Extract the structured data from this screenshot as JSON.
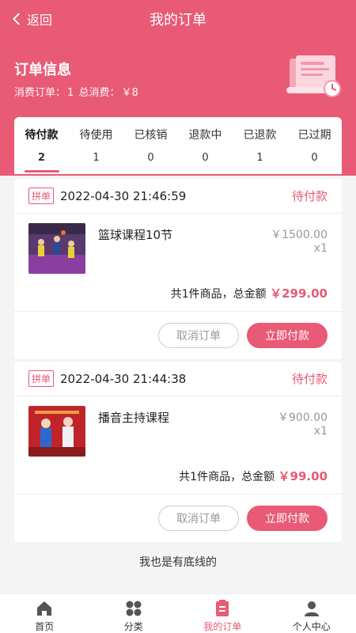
{
  "nav": {
    "back_label": "返回",
    "title": "我的订单"
  },
  "info": {
    "title": "订单信息",
    "orders_label": "消费订单：",
    "orders_count": "1",
    "total_label": "总消费：",
    "total_value": "￥8"
  },
  "tabs": [
    {
      "label": "待付款",
      "count": "2",
      "active": true
    },
    {
      "label": "待使用",
      "count": "1"
    },
    {
      "label": "已核销",
      "count": "0"
    },
    {
      "label": "退款中",
      "count": "0"
    },
    {
      "label": "已退款",
      "count": "1"
    },
    {
      "label": "已过期",
      "count": "0"
    }
  ],
  "orders": [
    {
      "badge": "拼单",
      "time": "2022-04-30 21:46:59",
      "status": "待付款",
      "product": "篮球课程10节",
      "price": "￥1500.00",
      "qty": "x1",
      "summary_prefix": "共1件商品，总金额",
      "amount": "￥299.00",
      "cancel_label": "取消订单",
      "pay_label": "立即付款"
    },
    {
      "badge": "拼单",
      "time": "2022-04-30 21:44:38",
      "status": "待付款",
      "product": "播音主持课程",
      "price": "￥900.00",
      "qty": "x1",
      "summary_prefix": "共1件商品，总金额",
      "amount": "￥99.00",
      "cancel_label": "取消订单",
      "pay_label": "立即付款"
    }
  ],
  "footer_note": "我也是有底线的",
  "tabbar": [
    {
      "label": "首页",
      "icon": "home-icon"
    },
    {
      "label": "分类",
      "icon": "category-icon"
    },
    {
      "label": "我的订单",
      "icon": "orders-icon",
      "active": true
    },
    {
      "label": "个人中心",
      "icon": "user-icon"
    }
  ],
  "colors": {
    "accent": "#e85a75",
    "background": "#f4f4f4"
  }
}
